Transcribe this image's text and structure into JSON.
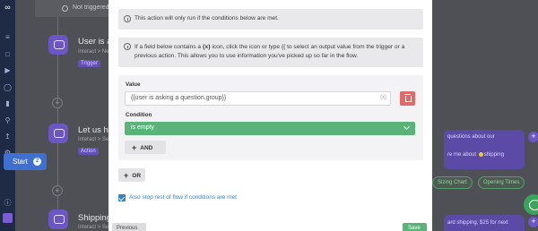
{
  "canvas": {
    "status": "Not triggered yet",
    "steps": [
      {
        "title": "User is asking",
        "subtitle": "Interact > New Int",
        "tag": "Trigger"
      },
      {
        "title": "Let us help y",
        "subtitle": "Interact > Send",
        "tag": "Action"
      },
      {
        "title": "Shipping",
        "subtitle": "Interact > Send"
      }
    ],
    "start_label": "Start",
    "start_badge": "2",
    "bubble_lines": [
      "questions about our",
      "",
      "re me about ",
      "shipping"
    ],
    "chips": [
      "Sizing Chart",
      "Opening Times"
    ],
    "bubble2_text": "ard shipping, $25 for next"
  },
  "modal": {
    "note1": "This action will only run if the conditions below are met.",
    "note2_part1": "If a field below contains a ",
    "note2_icon": "{x}",
    "note2_part2": " icon, click the icon or type {{ to select an output value from the trigger or a previous action. This allows you to use information you've picked up so far in the flow.",
    "value_label": "Value",
    "value_text": "{{user is asking a question.group}}",
    "condition_label": "Condition",
    "condition_value": "is empty",
    "and_label": "AND",
    "or_label": "OR",
    "checkbox_label": "Also stop rest of flow if conditions are met",
    "checkbox_checked": true,
    "previous_label": "Previous",
    "save_label": "Save"
  },
  "colors": {
    "accent_green": "#5ab47a",
    "accent_blue": "#2e86c9",
    "danger": "#e06a6a",
    "brand_purple": "#6c56c4"
  }
}
